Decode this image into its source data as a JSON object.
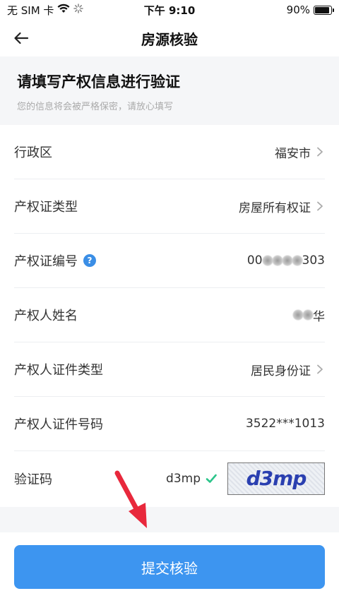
{
  "status_bar": {
    "carrier": "无 SIM 卡",
    "time": "下午 9:10",
    "battery": "90%",
    "battery_level": 0.9
  },
  "nav": {
    "title": "房源核验",
    "back_icon": "arrow-left-icon"
  },
  "intro": {
    "title": "请填写产权信息进行验证",
    "subtitle": "您的信息将会被严格保密，请放心填写"
  },
  "form": {
    "district": {
      "label": "行政区",
      "value": "福安市"
    },
    "cert_type": {
      "label": "产权证类型",
      "value": "房屋所有权证"
    },
    "cert_number": {
      "label": "产权证编号",
      "value_prefix": "00",
      "value_suffix": "303"
    },
    "owner_name": {
      "label": "产权人姓名",
      "value_suffix": "华"
    },
    "id_type": {
      "label": "产权人证件类型",
      "value": "居民身份证"
    },
    "id_number": {
      "label": "产权人证件号码",
      "value": "3522***1013"
    },
    "captcha": {
      "label": "验证码",
      "input_value": "d3mp",
      "image_text": "d3mp"
    }
  },
  "submit": {
    "label": "提交核验"
  },
  "colors": {
    "primary": "#3d95f0",
    "help": "#3a8ee6",
    "check": "#2bc48a",
    "background": "#f5f6f8"
  }
}
